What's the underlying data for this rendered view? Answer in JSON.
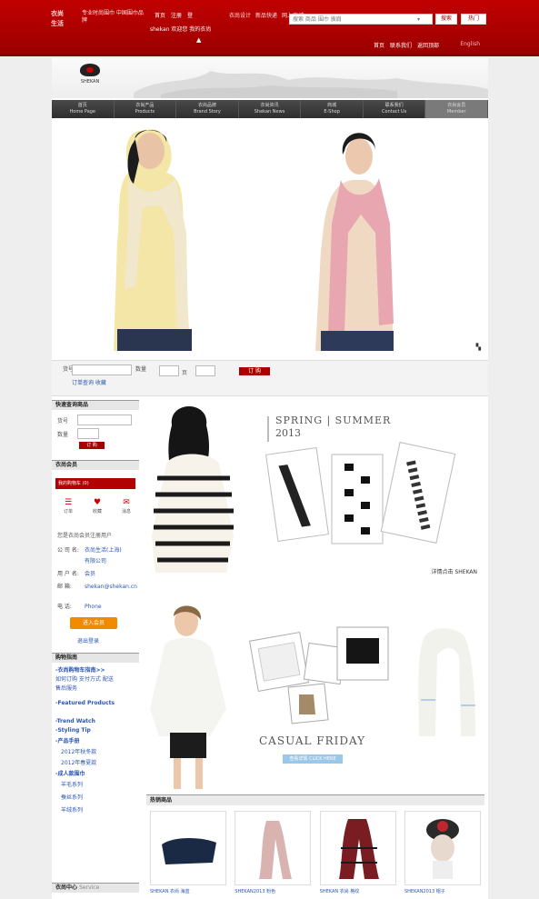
{
  "topbar": {
    "logo_text": "衣尚 生活",
    "tagline": "专业时尚围巾 中国围巾品牌",
    "nav": [
      "首页",
      "注册",
      "登"
    ],
    "nav2": [
      "衣尚设计",
      "新品快递",
      "网上商城"
    ],
    "user_line": "shekan 欢迎您 我的衣尚",
    "search_placeholder": "搜索 商品 围巾 披肩",
    "search_button": "搜索",
    "hot_button": "热门",
    "links": [
      "首页",
      "联系我们",
      "返回顶部"
    ],
    "lang": "English"
  },
  "brand": {
    "logo_caption": "SHEKAN"
  },
  "mainnav": [
    {
      "label": "首页",
      "sub": "Home Page"
    },
    {
      "label": "衣尚产品",
      "sub": "Products"
    },
    {
      "label": "衣尚品牌",
      "sub": "Brand Story"
    },
    {
      "label": "衣尚资讯",
      "sub": "Shekan News"
    },
    {
      "label": "商城",
      "sub": "E-Shop"
    },
    {
      "label": "联系我们",
      "sub": "Contact Us"
    },
    {
      "label": "衣尚会员",
      "sub": "Member"
    }
  ],
  "quickbar": {
    "label1": "货号",
    "label2": "数量",
    "label3": "页",
    "link": "订单查询 收藏",
    "button": "订 购"
  },
  "sidebar": {
    "quick_head": "快速查询商品",
    "q_label1": "货号",
    "q_label2": "数量",
    "q_btn": "订 购",
    "member_head": "衣尚会员",
    "cart_banner": "我的购物车 (0)",
    "cart_icons": [
      {
        "glyph": "☰",
        "label": "订单"
      },
      {
        "glyph": "♥",
        "label": "收藏"
      },
      {
        "glyph": "✉",
        "label": "消息"
      }
    ],
    "member_line": "您是衣尚会员注册用户",
    "kv": [
      {
        "k": "公 司 名:",
        "v": "衣尚生活(上海)"
      },
      {
        "k": "",
        "v": "有限公司"
      },
      {
        "k": "用 户 名:",
        "v": "会员"
      },
      {
        "k": "邮    箱:",
        "v": "shekan@shekan.cn"
      },
      {
        "k": "电    话:",
        "v": "Phone"
      }
    ],
    "orange_button": "进入会员",
    "logout_link": "退出登录",
    "guide_head": "购物指南",
    "guide_links": [
      {
        "text": "-衣尚购物车指南>>",
        "bold": true
      },
      {
        "text": "如何订购  支付方式  配送"
      },
      {
        "text": "售后服务"
      },
      {
        "text": "-Featured Products",
        "bold": true
      },
      {
        "text": "-Trend Watch",
        "bold": true
      },
      {
        "text": "-Styling Tip",
        "bold": true
      },
      {
        "text": "-产品手册",
        "bold": true
      },
      {
        "text": "2012年秋冬款"
      },
      {
        "text": "2012年春夏款"
      },
      {
        "text": "-成人款围巾",
        "bold": true
      },
      {
        "text": "羊毛系列"
      },
      {
        "text": "蚕丝系列"
      },
      {
        "text": "羊绒系列"
      }
    ],
    "footer_head": "衣尚中心",
    "footer_sub": "Service"
  },
  "promo1": {
    "title_line1": "SPRING | SUMMER",
    "title_line2": "2013",
    "link": "详情点击 SHEKAN"
  },
  "promo2": {
    "title": "CASUAL FRIDAY",
    "button": "查看详情 CLICK HERE"
  },
  "products": {
    "head": "热销商品",
    "items": [
      {
        "caption": "SHEKAN 衣尚 海蓝",
        "color": "#1b2a44"
      },
      {
        "caption": "SHEKAN2013 粉色",
        "color": "#d9b3b0"
      },
      {
        "caption": "SHEKAN 衣尚 格纹",
        "color": "#7a1d23"
      },
      {
        "caption": "SHEKAN2013 帽子",
        "color": "#2a2a2a"
      }
    ]
  }
}
